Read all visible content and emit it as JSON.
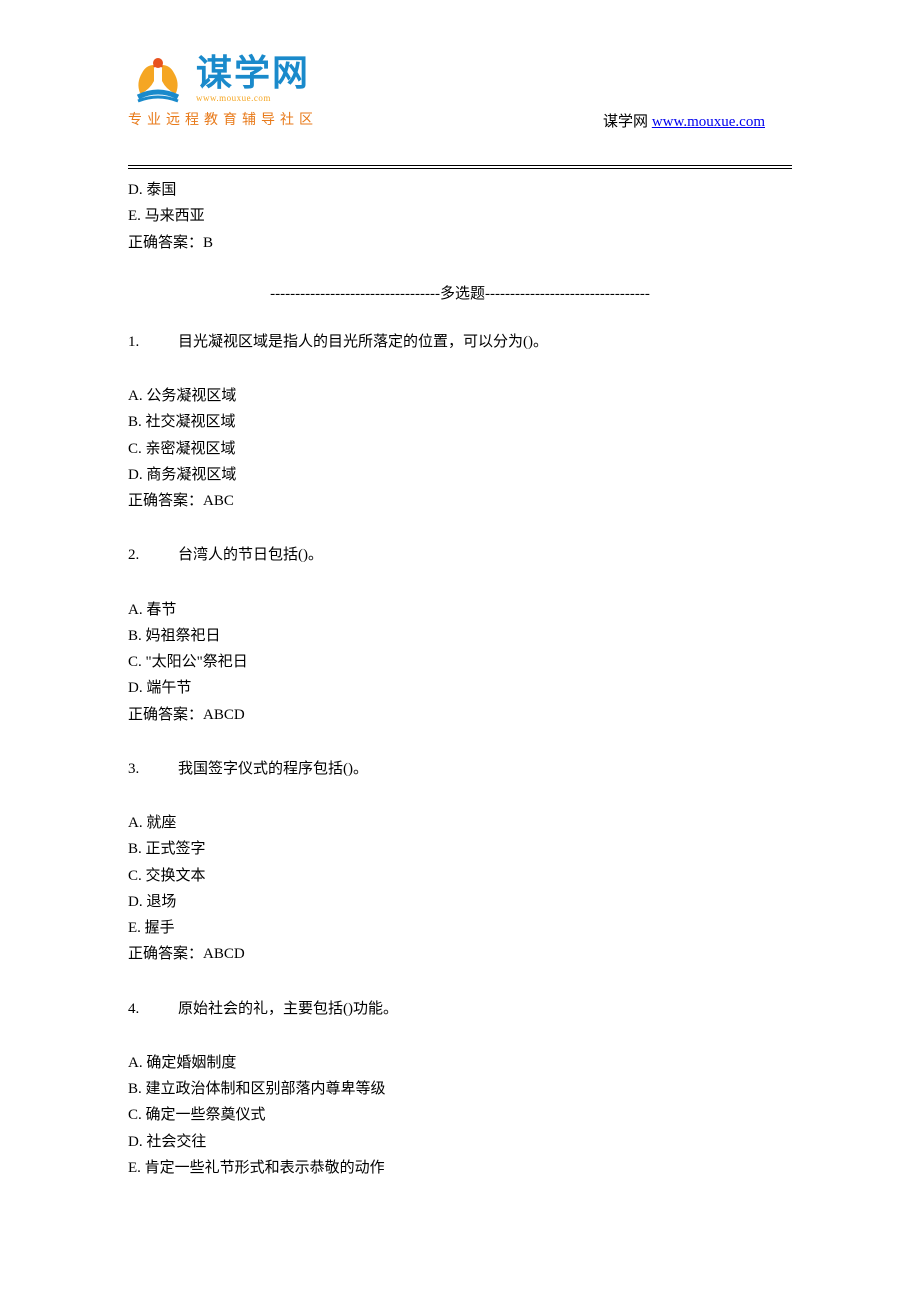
{
  "header": {
    "logo_chinese": "谋学网",
    "logo_url": "www.mouxue.com",
    "logo_tagline": "专业远程教育辅导社区",
    "right_text": "谋学网 ",
    "right_link": "www.mouxue.com"
  },
  "prev_question": {
    "option_d": "D. 泰国",
    "option_e": "E. 马来西亚",
    "answer": "正确答案：B"
  },
  "section_divider": "----------------------------------多选题---------------------------------",
  "questions": [
    {
      "num": "1.",
      "text": "目光凝视区域是指人的目光所落定的位置，可以分为()。",
      "options": [
        "A. 公务凝视区域",
        "B. 社交凝视区域",
        "C. 亲密凝视区域",
        "D. 商务凝视区域"
      ],
      "answer": "正确答案：ABC"
    },
    {
      "num": "2.",
      "text": "台湾人的节日包括()。",
      "options": [
        "A. 春节",
        "B. 妈祖祭祀日",
        "C. \"太阳公\"祭祀日",
        "D. 端午节"
      ],
      "answer": "正确答案：ABCD"
    },
    {
      "num": "3.",
      "text": "我国签字仪式的程序包括()。",
      "options": [
        "A. 就座",
        "B. 正式签字",
        "C. 交换文本",
        "D. 退场",
        "E. 握手"
      ],
      "answer": "正确答案：ABCD"
    },
    {
      "num": "4.",
      "text": "原始社会的礼，主要包括()功能。",
      "options": [
        "A. 确定婚姻制度",
        "B. 建立政治体制和区别部落内尊卑等级",
        "C. 确定一些祭奠仪式",
        "D. 社会交往",
        "E. 肯定一些礼节形式和表示恭敬的动作"
      ],
      "answer": ""
    }
  ]
}
